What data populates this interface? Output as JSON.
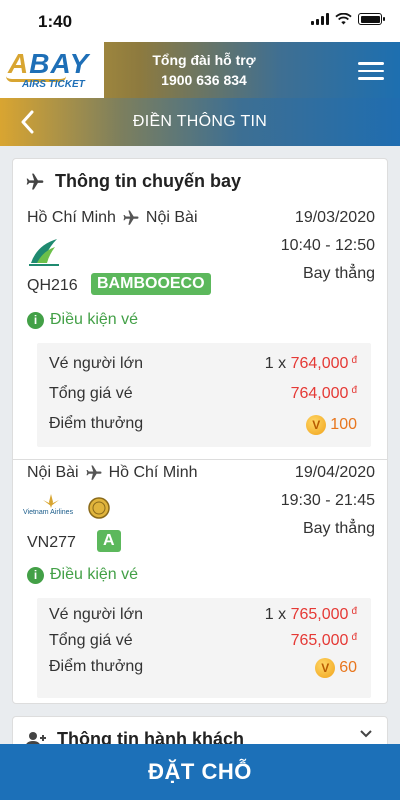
{
  "status_bar": {
    "time": "1:40"
  },
  "header": {
    "logo_text": "ABAY",
    "logo_sub": "AIRS TICKET",
    "hotline_label": "Tổng đài hỗ trợ",
    "hotline_number": "1900 636 834",
    "menu_icon": "hamburger-icon"
  },
  "titlebar": {
    "title": "ĐIỀN THÔNG TIN",
    "back_icon": "chevron-left-icon"
  },
  "flight_info": {
    "title": "Thông tin chuyến bay",
    "icon": "airplane-icon",
    "legs": [
      {
        "from": "Hồ Chí Minh",
        "to": "Nội Bài",
        "date": "19/03/2020",
        "time": "10:40 - 12:50",
        "type": "Bay thẳng",
        "airline_logo": "bamboo-airways-logo",
        "flight_no": "QH216",
        "fare_class": "BAMBOOECO",
        "conditions_label": "Điều kiện vé",
        "adult_label": "Vé người lớn",
        "adult_qty": "1 x",
        "adult_price": "764,000",
        "total_label": "Tổng giá vé",
        "total_price": "764,000",
        "points_label": "Điểm thưởng",
        "points": "100",
        "currency": "đ"
      },
      {
        "from": "Nội Bài",
        "to": "Hồ Chí Minh",
        "date": "19/04/2020",
        "time": "19:30 - 21:45",
        "type": "Bay thẳng",
        "airline_logo": "vietnam-airlines-logo",
        "airline_name": "Vietnam Airlines",
        "flight_no": "VN277",
        "fare_class": "A",
        "conditions_label": "Điều kiện vé",
        "adult_label": "Vé người lớn",
        "adult_qty": "1 x",
        "adult_price": "765,000",
        "total_label": "Tổng giá vé",
        "total_price": "765,000",
        "points_label": "Điểm thưởng",
        "points": "60",
        "currency": "đ"
      }
    ]
  },
  "passenger_info": {
    "title": "Thông tin hành khách",
    "icon": "add-user-icon",
    "chevron_icon": "chevron-down-icon"
  },
  "book_button": {
    "label": "ĐẶT CHỖ"
  },
  "colors": {
    "primary": "#1c70b8",
    "gold": "#d8a531",
    "price_red": "#e53935",
    "success_green": "#43a047",
    "badge_green": "#5cb85c"
  }
}
